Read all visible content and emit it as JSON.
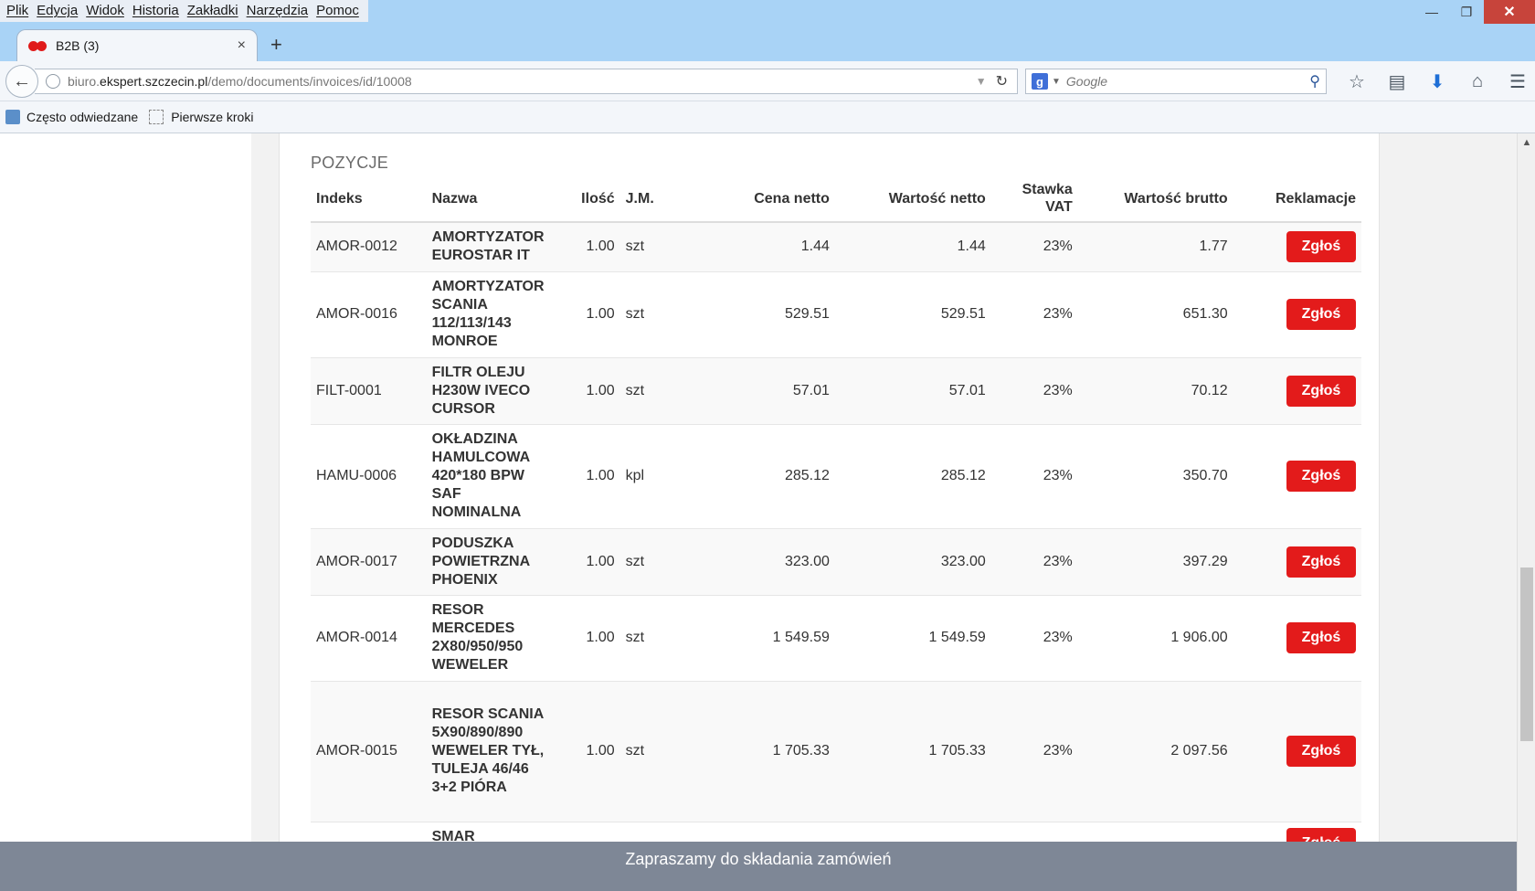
{
  "menu": [
    "Plik",
    "Edycja",
    "Widok",
    "Historia",
    "Zakładki",
    "Narzędzia",
    "Pomoc"
  ],
  "window_controls": {
    "minimize": "—",
    "restore": "❐",
    "close": "✕"
  },
  "tab": {
    "title": "B2B (3)",
    "close": "×",
    "new_tab": "+"
  },
  "navbar": {
    "url_prefix": "biuro.",
    "url_domain": "ekspert.szczecin.pl",
    "url_path": "/demo/documents/invoices/id/10008",
    "search_placeholder": "Google"
  },
  "bookmarks": [
    "Często odwiedzane",
    "Pierwsze kroki"
  ],
  "section_title": "POZYCJE",
  "columns": {
    "index": "Indeks",
    "name": "Nazwa",
    "qty": "Ilość",
    "unit": "J.M.",
    "net_price": "Cena netto",
    "net_value": "Wartość netto",
    "vat_line1": "Stawka",
    "vat_line2": "VAT",
    "gross_value": "Wartość brutto",
    "complaints": "Reklamacje"
  },
  "report_label": "Zgłoś",
  "rows": [
    {
      "index": "AMOR-0012",
      "name": "AMORTYZATOR EUROSTAR IT",
      "qty": "1.00",
      "unit": "szt",
      "net_price": "1.44",
      "net_value": "1.44",
      "vat": "23%",
      "gross": "1.77"
    },
    {
      "index": "AMOR-0016",
      "name": "AMORTYZATOR SCANIA 112/113/143 MONROE",
      "qty": "1.00",
      "unit": "szt",
      "net_price": "529.51",
      "net_value": "529.51",
      "vat": "23%",
      "gross": "651.30"
    },
    {
      "index": "FILT-0001",
      "name": "FILTR OLEJU H230W IVECO CURSOR",
      "qty": "1.00",
      "unit": "szt",
      "net_price": "57.01",
      "net_value": "57.01",
      "vat": "23%",
      "gross": "70.12"
    },
    {
      "index": "HAMU-0006",
      "name": "OKŁADZINA HAMULCOWA 420*180 BPW SAF NOMINALNA",
      "qty": "1.00",
      "unit": "kpl",
      "net_price": "285.12",
      "net_value": "285.12",
      "vat": "23%",
      "gross": "350.70"
    },
    {
      "index": "AMOR-0017",
      "name": "PODUSZKA POWIETRZNA PHOENIX",
      "qty": "1.00",
      "unit": "szt",
      "net_price": "323.00",
      "net_value": "323.00",
      "vat": "23%",
      "gross": "397.29"
    },
    {
      "index": "AMOR-0014",
      "name": "RESOR MERCEDES 2X80/950/950 WEWELER",
      "qty": "1.00",
      "unit": "szt",
      "net_price": "1 549.59",
      "net_value": "1 549.59",
      "vat": "23%",
      "gross": "1 906.00"
    },
    {
      "index": "AMOR-0015",
      "name": "RESOR SCANIA 5X90/890/890 WEWELER TYŁ, TULEJA 46/46 3+2 PIÓRA",
      "qty": "1.00",
      "unit": "szt",
      "net_price": "1 705.33",
      "net_value": "1 705.33",
      "vat": "23%",
      "gross": "2 097.56"
    },
    {
      "index": "",
      "name": "SMAR",
      "qty": "",
      "unit": "",
      "net_price": "",
      "net_value": "",
      "vat": "",
      "gross": ""
    }
  ],
  "footer": "Zapraszamy do składania zamówień"
}
